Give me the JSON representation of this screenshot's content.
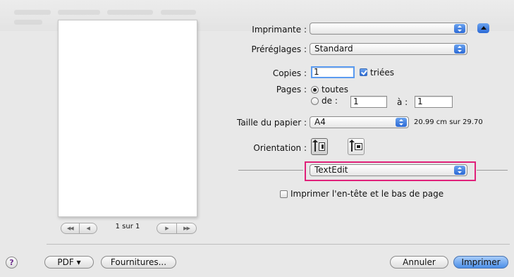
{
  "printer": {
    "label": "Imprimante :",
    "value": ""
  },
  "presets": {
    "label": "Préréglages :",
    "value": "Standard"
  },
  "copies": {
    "label": "Copies :",
    "value": "1",
    "collated_label": "triées",
    "collated_checked": true
  },
  "pages": {
    "label": "Pages :",
    "all_label": "toutes",
    "from_label": "de :",
    "from_value": "1",
    "to_label": "à :",
    "to_value": "1",
    "all_selected": true
  },
  "paper": {
    "label": "Taille du papier :",
    "value": "A4",
    "dimensions": "20.99 cm sur 29.70"
  },
  "orientation": {
    "label": "Orientation :",
    "selected": "portrait"
  },
  "section_popup": {
    "value": "TextEdit"
  },
  "header_footer": {
    "label": "Imprimer l'en-tête et le bas de page",
    "checked": false
  },
  "preview": {
    "page_indicator": "1 sur 1",
    "nav_first": "◀◀",
    "nav_prev": "◀",
    "nav_next": "▶",
    "nav_last": "▶▶"
  },
  "footer": {
    "help": "?",
    "pdf": "PDF ▾",
    "supplies": "Fournitures...",
    "cancel": "Annuler",
    "print": "Imprimer"
  },
  "colors": {
    "highlight": "#e0217a",
    "accent": "#3a7ee0"
  }
}
